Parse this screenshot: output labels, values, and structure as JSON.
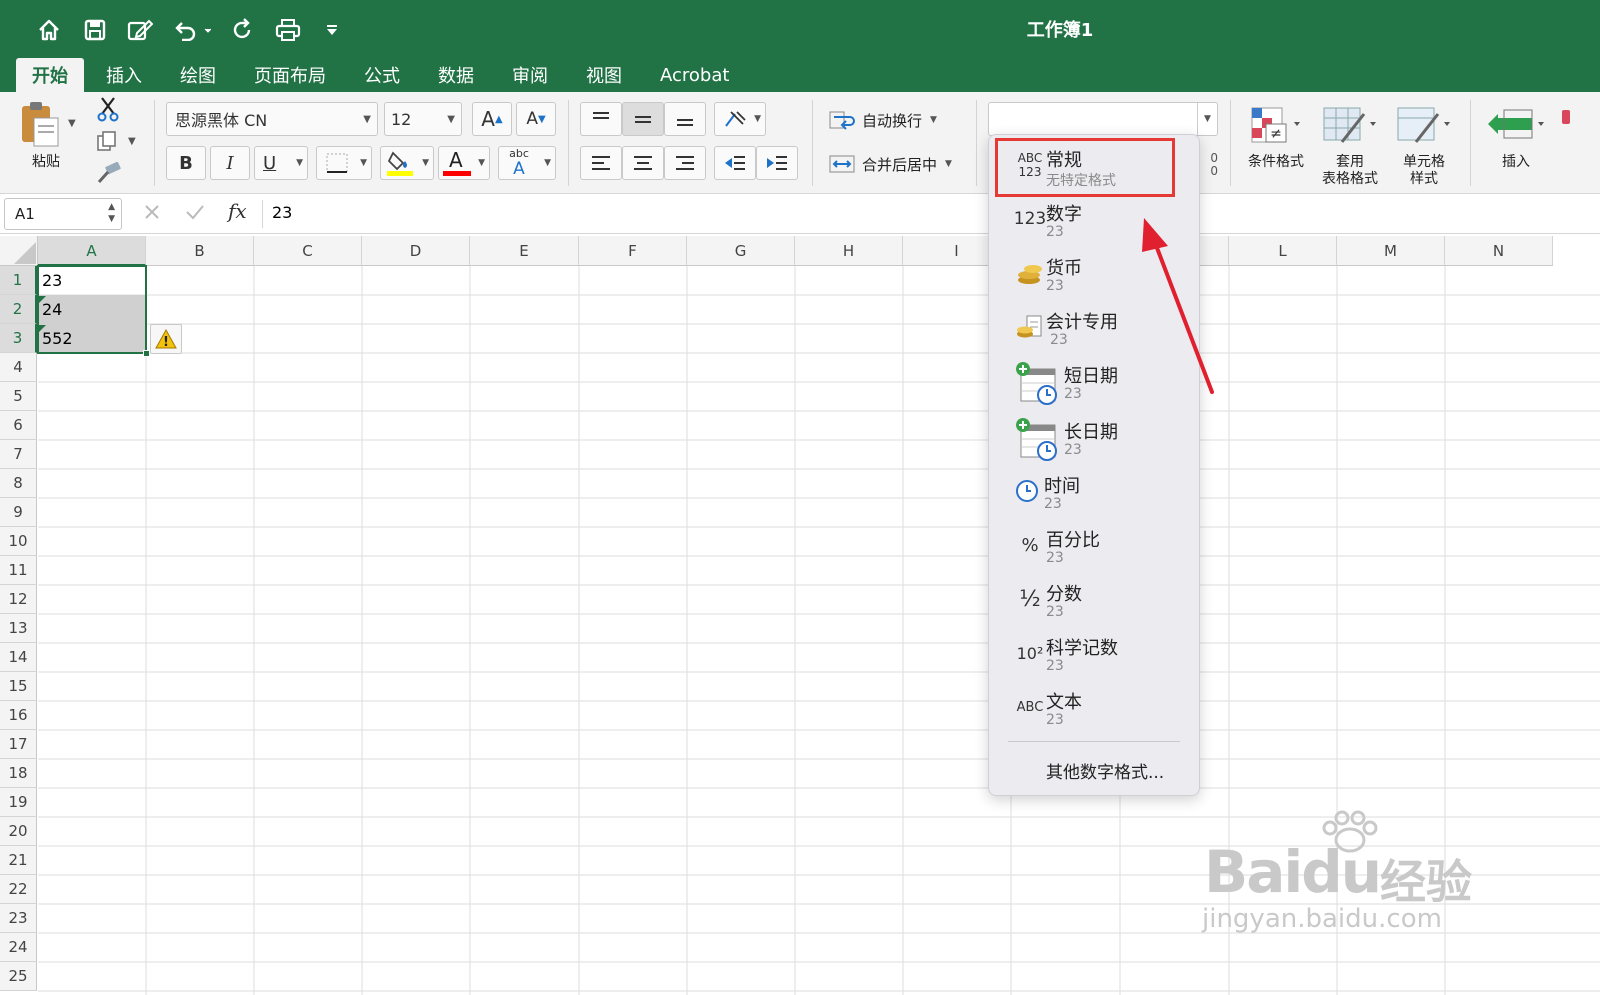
{
  "window": {
    "title": "工作簿1"
  },
  "quick_access": {
    "icons": [
      "home-icon",
      "save-icon",
      "edit-icon",
      "undo-icon",
      "redo-icon",
      "print-icon",
      "customize-icon"
    ]
  },
  "tabs": [
    {
      "label": "开始"
    },
    {
      "label": "插入"
    },
    {
      "label": "绘图"
    },
    {
      "label": "页面布局"
    },
    {
      "label": "公式"
    },
    {
      "label": "数据"
    },
    {
      "label": "审阅"
    },
    {
      "label": "视图"
    },
    {
      "label": "Acrobat"
    }
  ],
  "ribbon": {
    "paste_label": "粘贴",
    "font_name": "思源黑体 CN",
    "font_size": "12",
    "font_grow_glyph": "A",
    "font_shrink_glyph": "A",
    "bold": "B",
    "italic": "I",
    "underline": "U",
    "highlight_color": "#ffff00",
    "font_color": "#ff0000",
    "font_color_glyph": "A",
    "phonetic_top": "abc",
    "phonetic_bottom": "A",
    "wrap_text": "自动换行",
    "merge_center": "合并后居中",
    "number_format_value": "",
    "decimal_partial": "0\n0",
    "conditional_format": "条件格式",
    "table_format_line1": "套用",
    "table_format_line2": "表格格式",
    "cell_style_line1": "单元格",
    "cell_style_line2": "样式",
    "insert": "插入"
  },
  "formula_bar": {
    "name_box": "A1",
    "fx": "fx",
    "value": "23"
  },
  "sheet": {
    "columns": [
      "A",
      "B",
      "C",
      "D",
      "E",
      "F",
      "G",
      "H",
      "I",
      "L",
      "M",
      "N"
    ],
    "rows": [
      "1",
      "2",
      "3",
      "4",
      "5",
      "6",
      "7",
      "8",
      "9",
      "10",
      "11",
      "12",
      "13",
      "14",
      "15",
      "16",
      "17",
      "18",
      "19",
      "20",
      "21",
      "22",
      "23",
      "24",
      "25"
    ],
    "cells": {
      "A1": "23",
      "A2": "24",
      "A3": "552"
    },
    "warning_glyph": "!"
  },
  "number_format_menu": {
    "items": [
      {
        "icon": "general-icon",
        "icon_text_top": "ABC",
        "icon_text_bottom": "123",
        "name": "常规",
        "sample": "无特定格式"
      },
      {
        "icon": "number-icon",
        "icon_text": "123",
        "name": "数字",
        "sample": "23"
      },
      {
        "icon": "currency-coins-icon",
        "name": "货币",
        "sample": "23"
      },
      {
        "icon": "accounting-icon",
        "name": "会计专用",
        "sample": "23"
      },
      {
        "icon": "short-date-calendar-icon",
        "name": "短日期",
        "sample": "23"
      },
      {
        "icon": "long-date-calendar-icon",
        "name": "长日期",
        "sample": "23"
      },
      {
        "icon": "time-clock-icon",
        "name": "时间",
        "sample": "23"
      },
      {
        "icon": "percent-icon",
        "icon_text": "%",
        "name": "百分比",
        "sample": "23"
      },
      {
        "icon": "fraction-icon",
        "icon_text": "½",
        "name": "分数",
        "sample": "23"
      },
      {
        "icon": "scientific-icon",
        "icon_text": "10²",
        "name": "科学记数",
        "sample": "23"
      },
      {
        "icon": "text-icon",
        "icon_text": "ABC",
        "name": "文本",
        "sample": "23"
      }
    ],
    "more": "其他数字格式..."
  },
  "colors": {
    "brand": "#217346",
    "highlight_border": "#e53935",
    "arrow": "#e0202e"
  },
  "watermark": {
    "brand": "Baidu",
    "cn": "经验",
    "url": "jingyan.baidu.com"
  }
}
